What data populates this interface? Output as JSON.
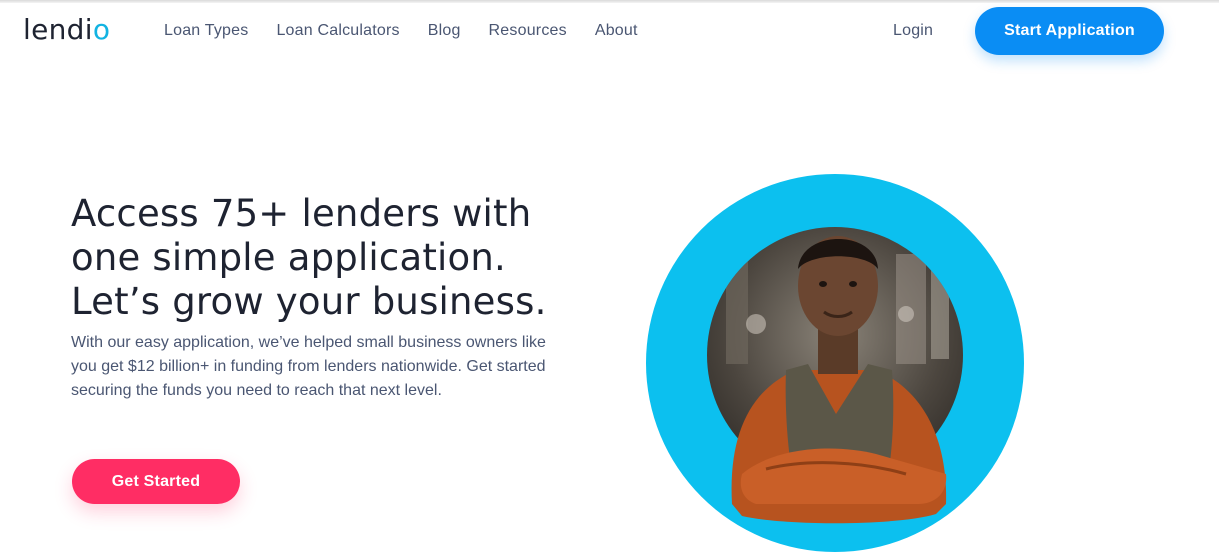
{
  "header": {
    "logo": {
      "prefix": "lendi",
      "accent": "o"
    },
    "nav": [
      {
        "label": "Loan Types"
      },
      {
        "label": "Loan Calculators"
      },
      {
        "label": "Blog"
      },
      {
        "label": "Resources"
      },
      {
        "label": "About"
      }
    ],
    "login_label": "Login",
    "start_label": "Start Application"
  },
  "hero": {
    "title_lines": [
      "Access 75+ lenders with",
      "one simple application.",
      "Let’s grow your business."
    ],
    "body_lines": [
      "With our easy application, we’ve helped small business owners like",
      "you get $12 billion+ in funding from lenders nationwide. Get started",
      "securing the funds you need to reach that next level."
    ],
    "cta_label": "Get Started"
  },
  "colors": {
    "brand_blue": "#0a8df4",
    "circle_cyan": "#0cc0ef",
    "cta_pink": "#ff2d64",
    "heading": "#1e2331",
    "body_text": "#4a5672"
  }
}
